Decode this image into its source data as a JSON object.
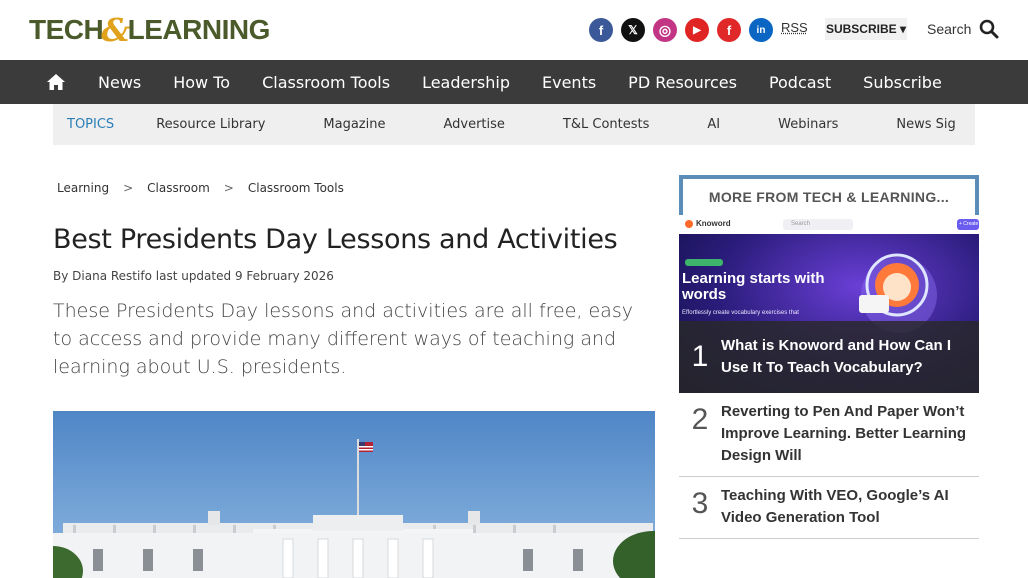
{
  "header": {
    "logo_part1": "TECH",
    "logo_amp": "&",
    "logo_part2": "LEARNING",
    "social": [
      {
        "icon": "facebook-icon",
        "glyph": "f",
        "color": "#3b5998"
      },
      {
        "icon": "x-icon",
        "glyph": "𝕏",
        "color": "#111111"
      },
      {
        "icon": "instagram-icon",
        "glyph": "◎",
        "color": "#c13584"
      },
      {
        "icon": "youtube-icon",
        "glyph": "▶",
        "color": "#e02424"
      },
      {
        "icon": "flipboard-icon",
        "glyph": "f",
        "color": "#e12828"
      },
      {
        "icon": "linkedin-icon",
        "glyph": "in",
        "color": "#0a66c2"
      }
    ],
    "rss": "RSS",
    "subscribe": "SUBSCRIBE ▾",
    "search": "Search"
  },
  "nav": {
    "items": [
      "News",
      "How To",
      "Classroom Tools",
      "Leadership",
      "Events",
      "PD Resources",
      "Podcast",
      "Subscribe"
    ]
  },
  "topics": {
    "label": "TOPICS",
    "items": [
      "Resource Library",
      "Magazine",
      "Advertise",
      "T&L Contests",
      "AI",
      "Webinars",
      "News Sig"
    ]
  },
  "breadcrumb": [
    "Learning",
    ">",
    "Classroom",
    ">",
    "Classroom Tools"
  ],
  "article": {
    "title": "Best Presidents Day Lessons and Activities",
    "by": "By",
    "author": "Diana Restifo",
    "updated_label": "last updated",
    "date": "9 February 2026",
    "lede": "These Presidents Day lessons and activities are all free, easy to access and provide many different ways of teaching and learning about U.S. presidents."
  },
  "more": {
    "heading": "MORE FROM TECH & LEARNING...",
    "featured_image_text": {
      "brand": "Knoword",
      "headline": "Learning starts with words",
      "sub": "Effortlessly create vocabulary exercises that",
      "search_placeholder": "Search",
      "create": "+ Create"
    },
    "items": [
      {
        "num": "1",
        "title": "What is Knoword and How Can I Use It To Teach Vocabulary?"
      },
      {
        "num": "2",
        "title": "Reverting to Pen And Paper Won’t Improve Learning. Better Learning Design Will"
      },
      {
        "num": "3",
        "title": "Teaching With VEO, Google’s AI Video Generation Tool"
      }
    ]
  },
  "colors": {
    "nav_bg": "#3b3b3b",
    "topics_label": "#2a7fb8",
    "logo_green": "#4b5a2a",
    "logo_amp": "#e0a21a",
    "more_border": "#5b8db8"
  }
}
